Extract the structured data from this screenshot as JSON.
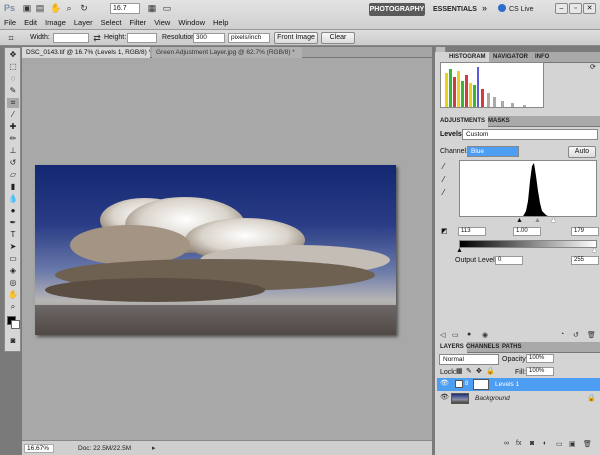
{
  "app": {
    "logo": "Ps",
    "menu": [
      "File",
      "Edit",
      "Image",
      "Layer",
      "Select",
      "Filter",
      "View",
      "Window",
      "Help"
    ],
    "zoom": "16.7",
    "workspaces": {
      "active": "PHOTOGRAPHY",
      "other": "ESSENTIALS",
      "more": "»"
    },
    "cs_live": "CS Live"
  },
  "options": {
    "width_label": "Width:",
    "height_label": "Height:",
    "resolution_label": "Resolution:",
    "resolution_value": "300",
    "units": "pixels/inch",
    "front_image": "Front Image",
    "clear": "Clear"
  },
  "tabs": [
    "DSC_0143.tif @ 16.7% (Levels 1, RGB/8) *",
    "Green Adjustment Layer.jpg @ 62.7% (RGB/8) *"
  ],
  "status": {
    "zoom": "16.67%",
    "doc": "Doc: 22.5M/22.5M"
  },
  "histogram_tabs": [
    "HISTOGRAM",
    "NAVIGATOR",
    "INFO"
  ],
  "adjustments": {
    "tabs": [
      "ADJUSTMENTS",
      "MASKS"
    ],
    "preset_label": "Levels",
    "preset_value": "Custom",
    "channel_label": "Channel:",
    "channel_value": "Blue",
    "auto": "Auto",
    "input": {
      "black": "113",
      "gamma": "1.00",
      "white": "179"
    },
    "output_label": "Output Levels:",
    "output": {
      "black": "0",
      "white": "255"
    }
  },
  "layers": {
    "tabs": [
      "LAYERS",
      "CHANNELS",
      "PATHS"
    ],
    "blend": "Normal",
    "opacity_label": "Opacity:",
    "opacity": "100%",
    "lock_label": "Lock:",
    "fill_label": "Fill:",
    "fill": "100%",
    "items": [
      {
        "name": "Levels 1"
      },
      {
        "name": "Background"
      }
    ]
  },
  "colors": {
    "accent": "#4d9df2",
    "workspace_active": "#5a5a5a"
  }
}
